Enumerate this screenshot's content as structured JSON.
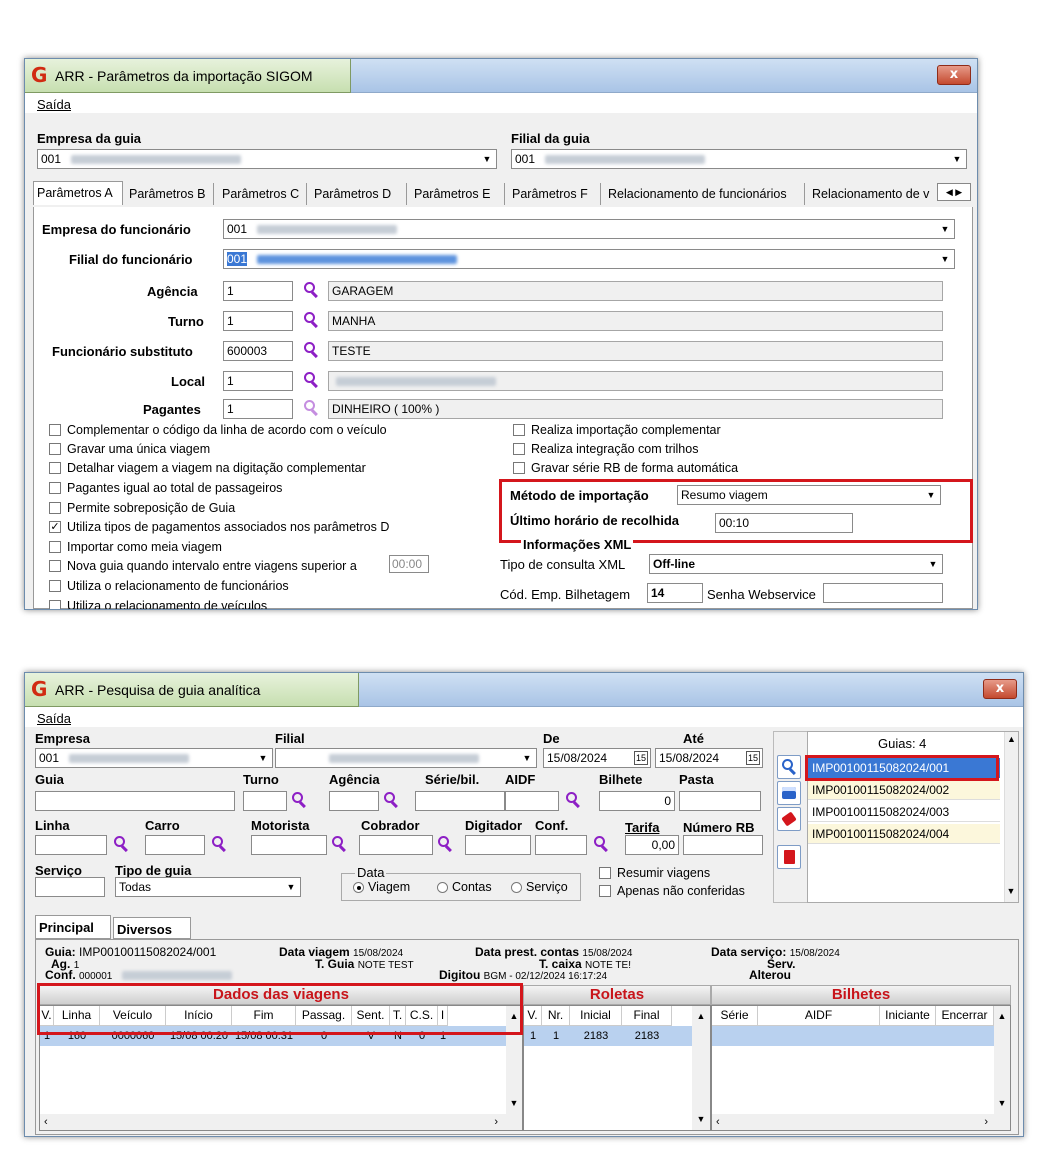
{
  "win1": {
    "title": "ARR - Parâmetros da importação  SIGOM",
    "menu": "Saída",
    "close": "x",
    "empresa_guia_label": "Empresa  da guia",
    "empresa_guia_value": "001",
    "filial_guia_label": "Filial  da guia",
    "filial_guia_value": "001",
    "tabs": [
      "Parâmetros A",
      "Parâmetros B",
      "Parâmetros C",
      "Parâmetros D",
      "Parâmetros E",
      "Parâmetros F",
      "Relacionamento de funcionários",
      "Relacionamento de v"
    ],
    "fields": {
      "empresa_func_label": "Empresa do funcionário",
      "empresa_func_value": "001",
      "filial_func_label": "Filial do funcionário",
      "filial_func_value": "001",
      "agencia_label": "Agência",
      "agencia_value": "1",
      "agencia_desc": "GARAGEM",
      "turno_label": "Turno",
      "turno_value": "1",
      "turno_desc": "MANHA",
      "func_sub_label": "Funcionário substituto",
      "func_sub_value": "600003",
      "func_sub_desc": "TESTE",
      "local_label": "Local",
      "local_value": "1",
      "pagantes_label": "Pagantes",
      "pagantes_value": "1",
      "pagantes_desc": "DINHEIRO ( 100% )"
    },
    "checks_left": [
      {
        "label": "Complementar o  código da linha de acordo com o veículo",
        "checked": false
      },
      {
        "label": "Gravar uma única viagem",
        "checked": false
      },
      {
        "label": "Detalhar viagem a viagem na digitação complementar",
        "checked": false
      },
      {
        "label": "Pagantes igual ao total de passageiros",
        "checked": false
      },
      {
        "label": "Permite sobreposição de Guia",
        "checked": false
      },
      {
        "label": "Utiliza tipos de pagamentos associados nos parâmetros D",
        "checked": true
      },
      {
        "label": "Importar como meia viagem",
        "checked": false
      },
      {
        "label": "Nova guia quando intervalo entre viagens superior a",
        "checked": false
      },
      {
        "label": "Utiliza o relacionamento de funcionários",
        "checked": false
      },
      {
        "label": "Utiliza o relacionamento de veículos",
        "checked": false
      }
    ],
    "interval_value": "00:00",
    "checks_right": [
      {
        "label": "Realiza importação complementar",
        "checked": false
      },
      {
        "label": "Realiza integração com trilhos",
        "checked": false
      },
      {
        "label": "Gravar série RB de forma automática",
        "checked": false
      }
    ],
    "metodo_label": "Método de importação",
    "metodo_value": "Resumo viagem",
    "ultimo_label": "Último horário de recolhida",
    "ultimo_value": "00:10",
    "xml_group": "Informações XML",
    "tipo_consulta_label": "Tipo de consulta XML",
    "tipo_consulta_value": "Off-line",
    "cod_emp_label": "Cód. Emp. Bilhetagem",
    "cod_emp_value": "14",
    "senha_label": "Senha Webservice"
  },
  "win2": {
    "title": "ARR - Pesquisa de guia analítica",
    "menu": "Saída",
    "close": "x",
    "labels": {
      "empresa": "Empresa",
      "filial": "Filial",
      "de": "De",
      "ate": "Até",
      "guia": "Guia",
      "turno": "Turno",
      "agencia": "Agência",
      "serie": "Série/bil.",
      "aidf": "AIDF",
      "bilhete": "Bilhete",
      "pasta": "Pasta",
      "linha": "Linha",
      "carro": "Carro",
      "motorista": "Motorista",
      "cobrador": "Cobrador",
      "digitador": "Digitador",
      "conf": "Conf.",
      "tarifa": "Tarifa",
      "numero_rb": "Número RB",
      "servico": "Serviço",
      "tipo_guia": "Tipo de guia",
      "data": "Data"
    },
    "empresa_value": "001",
    "de_value": "15/08/2024",
    "ate_value": "15/08/2024",
    "cal": "15",
    "bilhete_value": "0",
    "tarifa_value": "0,00",
    "tipo_guia_value": "Todas",
    "radios": [
      {
        "label": "Viagem",
        "on": true
      },
      {
        "label": "Contas",
        "on": false
      },
      {
        "label": "Serviço",
        "on": false
      }
    ],
    "resumir": "Resumir viagens",
    "apenas": "Apenas não conferidas",
    "guias_header": "Guias: 4",
    "guias": [
      "IMP00100115082024/001",
      "IMP00100115082024/002",
      "IMP00100115082024/003",
      "IMP00100115082024/004"
    ],
    "tabs": [
      "Principal",
      "Diversos"
    ],
    "info": {
      "guia_label": "Guia:",
      "guia_value": "IMP00100115082024/001",
      "ag_label": "Ag.",
      "ag_value": "1",
      "conf_label": "Conf.",
      "conf_value": "000001",
      "data_viagem_label": "Data viagem",
      "data_viagem_value": "15/08/2024",
      "t_guia_label": "T. Guia",
      "t_guia_value": "NOTE TEST",
      "prest_label": "Data prest. contas",
      "prest_value": "15/08/2024",
      "tcaixa_label": "T. caixa",
      "tcaixa_value": "NOTE TE!",
      "digitou_label": "Digitou",
      "digitou_value": "BGM - 02/12/2024 16:17:24",
      "servico_label": "Data serviço:",
      "servico_value": "15/08/2024",
      "serv_label": "Serv.",
      "alterou_label": "Alterou"
    },
    "sections": [
      "Dados das viagens",
      "Roletas",
      "Bilhetes"
    ],
    "viagens_cols": [
      "V.",
      "Linha",
      "Veículo",
      "Início",
      "Fim",
      "Passag.",
      "Sent.",
      "T.",
      "C.S.",
      "I"
    ],
    "viagens_row": [
      "1",
      "160",
      "0000060",
      "15/08 00:20",
      "15/08 00:31",
      "0",
      "V",
      "N",
      "0",
      "1"
    ],
    "roletas_cols": [
      "V.",
      "Nr.",
      "Inicial",
      "Final"
    ],
    "roletas_row": [
      "1",
      "1",
      "2183",
      "2183"
    ],
    "bilhetes_cols": [
      "Série",
      "AIDF",
      "Iniciante",
      "Encerrar"
    ]
  }
}
